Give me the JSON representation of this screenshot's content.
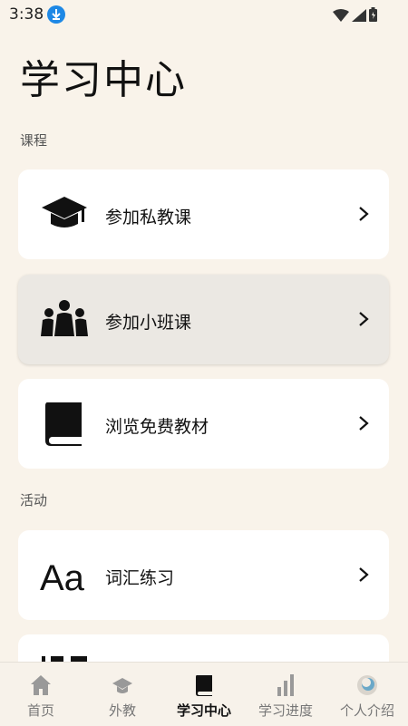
{
  "status": {
    "time": "3:38"
  },
  "page": {
    "title": "学习中心"
  },
  "sections": {
    "courses": {
      "label": "课程",
      "items": [
        {
          "label": "参加私教课",
          "icon": "graduation-cap-icon"
        },
        {
          "label": "参加小班课",
          "icon": "group-icon"
        },
        {
          "label": "浏览免费教材",
          "icon": "book-icon"
        }
      ]
    },
    "activities": {
      "label": "活动",
      "items": [
        {
          "label": "词汇练习",
          "icon": "text-aa-icon"
        }
      ]
    }
  },
  "nav": [
    {
      "label": "首页",
      "icon": "home-icon"
    },
    {
      "label": "外教",
      "icon": "teacher-cap-icon"
    },
    {
      "label": "学习中心",
      "icon": "book-icon",
      "active": true
    },
    {
      "label": "学习进度",
      "icon": "bar-chart-icon"
    },
    {
      "label": "个人介绍",
      "icon": "avatar-icon"
    }
  ],
  "colors": {
    "background": "#f9f3ea",
    "card": "#ffffff",
    "pressed_card": "#ebe8e3",
    "download_badge": "#1e88e5"
  }
}
